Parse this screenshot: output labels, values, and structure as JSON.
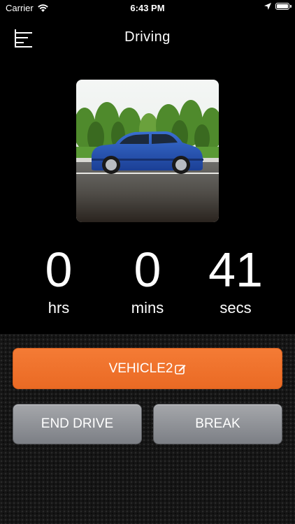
{
  "status_bar": {
    "carrier": "Carrier",
    "time": "6:43 PM",
    "icons": [
      "wifi-icon",
      "location-arrow-icon",
      "battery-icon"
    ]
  },
  "header": {
    "title": "Driving",
    "menu_icon": "hamburger-menu-icon"
  },
  "car_image": {
    "description_icon": "car-photo"
  },
  "timer": {
    "hours": "0",
    "hours_label": "hrs",
    "minutes": "0",
    "minutes_label": "mins",
    "seconds": "41",
    "seconds_label": "secs"
  },
  "actions": {
    "vehicle_label": "VEHICLE2",
    "vehicle_icon": "edit-icon",
    "end_drive_label": "END DRIVE",
    "break_label": "BREAK"
  },
  "colors": {
    "accent_orange": "#f47b35",
    "button_gray": "#8e9196",
    "background": "#000000"
  }
}
